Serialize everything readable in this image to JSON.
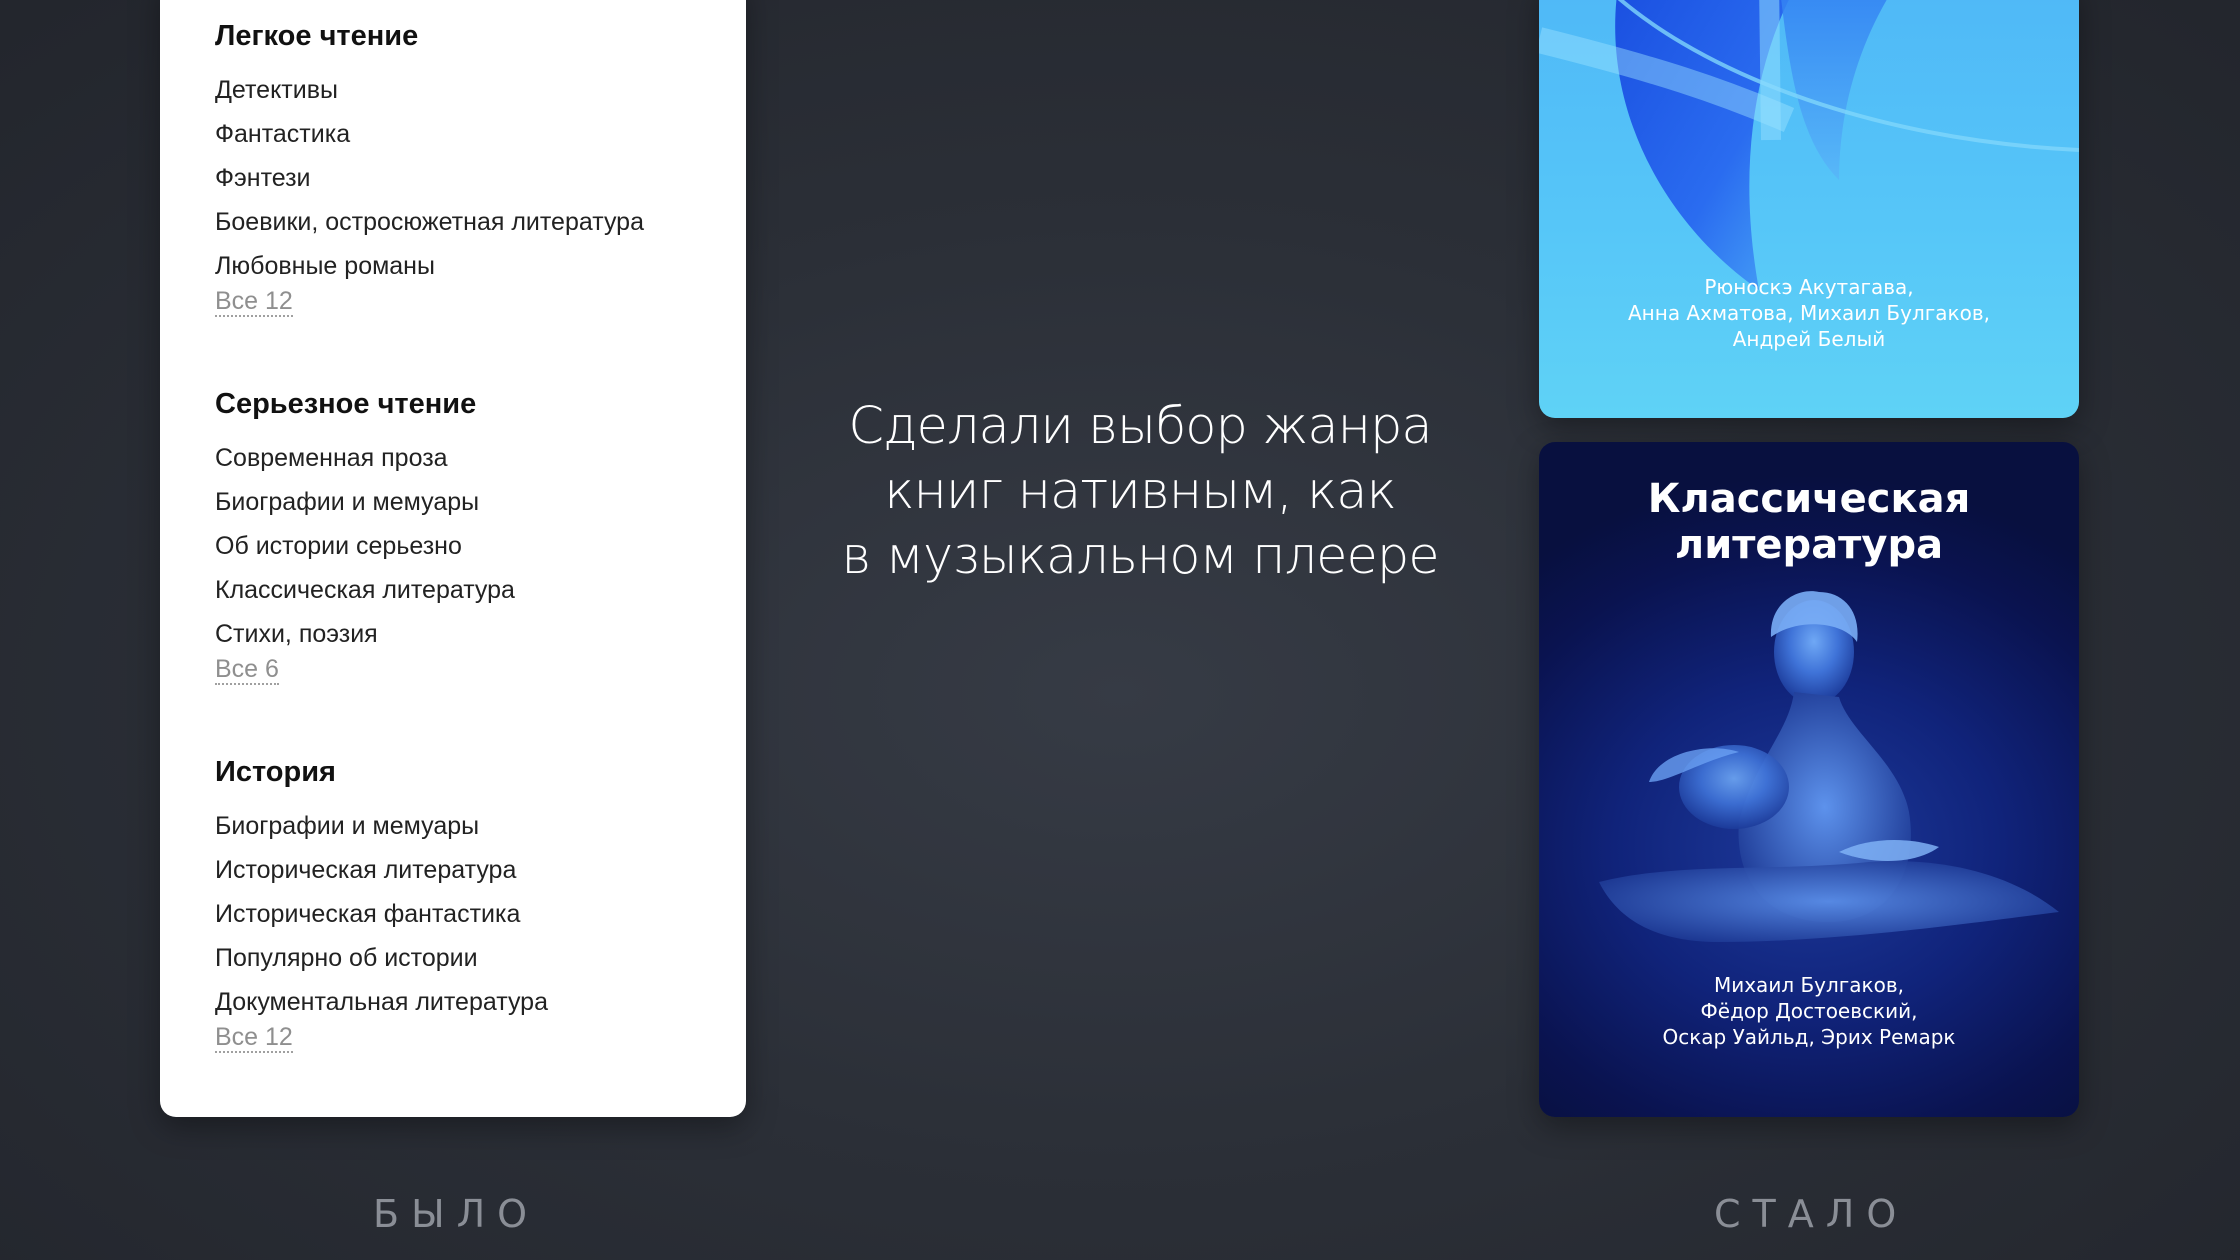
{
  "old_panel": {
    "groups": [
      {
        "title": "Легкое чтение",
        "items": [
          "Детективы",
          "Фантастика",
          "Фэнтези",
          "Боевики, остросюжетная литература",
          "Любовные романы"
        ],
        "all_label": "Все 12"
      },
      {
        "title": "Серьезное чтение",
        "items": [
          "Современная проза",
          "Биографии и мемуары",
          "Об истории серьезно",
          "Классическая литература",
          "Стихи, поэзия"
        ],
        "all_label": "Все 6"
      },
      {
        "title": "История",
        "items": [
          "Биографии и мемуары",
          "Историческая литература",
          "Историческая фантастика",
          "Популярно об истории",
          "Документальная литература"
        ],
        "all_label": "Все 12"
      }
    ]
  },
  "headline": "Сделали выбор жанра\nкниг нативным, как\nв музыкальном плеере",
  "cards": {
    "top": {
      "authors": "Рюноскэ Акутагава,\nАнна Ахматова, Михаил Булгаков,\nАндрей Белый"
    },
    "bottom": {
      "title": "Классическая\nлитература",
      "authors": "Михаил Булгаков,\nФёдор Достоевский,\nОскар Уайльд, Эрих Ремарк"
    }
  },
  "labels": {
    "before": "БЫЛО",
    "after": "СТАЛО"
  },
  "colors": {
    "background": "#2b2f37",
    "card_top_blue": "#56c6f8",
    "card_bottom_navy": "#10237a"
  }
}
